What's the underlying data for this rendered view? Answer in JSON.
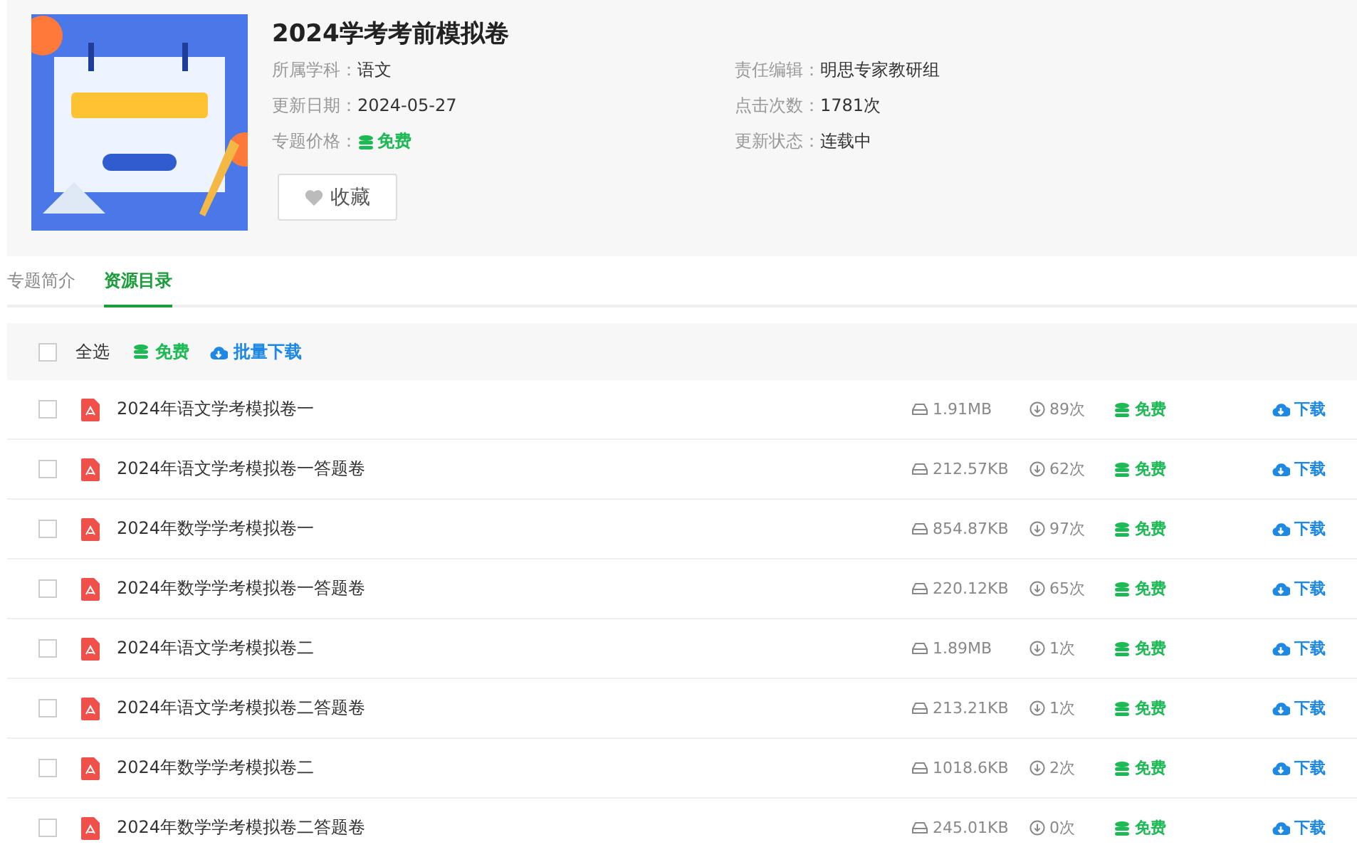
{
  "header": {
    "title": "2024学考考前模拟卷",
    "info": [
      {
        "label": "所属学科：",
        "value": "语文",
        "kind": "text"
      },
      {
        "label": "责任编辑：",
        "value": "明思专家教研组",
        "kind": "text"
      },
      {
        "label": "更新日期：",
        "value": "2024-05-27",
        "kind": "text"
      },
      {
        "label": "点击次数：",
        "value": "1781次",
        "kind": "text"
      },
      {
        "label": "专题价格：",
        "value": "免费",
        "kind": "price"
      },
      {
        "label": "更新状态：",
        "value": "连载中",
        "kind": "text"
      }
    ],
    "favorite_button": "收藏"
  },
  "tabs": [
    {
      "label": "专题简介",
      "selected": false
    },
    {
      "label": "资源目录",
      "selected": true
    }
  ],
  "toolbar": {
    "select_all": {
      "label": "全选",
      "checked": false
    },
    "free": "免费",
    "batch_download": "批量下载"
  },
  "files": [
    {
      "name": "2024年语文学考模拟卷一",
      "size": "1.91MB",
      "downloads": "89次",
      "price": "免费",
      "action": "下载",
      "checked": false
    },
    {
      "name": "2024年语文学考模拟卷一答题卷",
      "size": "212.57KB",
      "downloads": "62次",
      "price": "免费",
      "action": "下载",
      "checked": false
    },
    {
      "name": "2024年数学学考模拟卷一",
      "size": "854.87KB",
      "downloads": "97次",
      "price": "免费",
      "action": "下载",
      "checked": false
    },
    {
      "name": "2024年数学学考模拟卷一答题卷",
      "size": "220.12KB",
      "downloads": "65次",
      "price": "免费",
      "action": "下载",
      "checked": false
    },
    {
      "name": "2024年语文学考模拟卷二",
      "size": "1.89MB",
      "downloads": "1次",
      "price": "免费",
      "action": "下载",
      "checked": false
    },
    {
      "name": "2024年语文学考模拟卷二答题卷",
      "size": "213.21KB",
      "downloads": "1次",
      "price": "免费",
      "action": "下载",
      "checked": false
    },
    {
      "name": "2024年数学学考模拟卷二",
      "size": "1018.6KB",
      "downloads": "2次",
      "price": "免费",
      "action": "下载",
      "checked": false
    },
    {
      "name": "2024年数学学考模拟卷二答题卷",
      "size": "245.01KB",
      "downloads": "0次",
      "price": "免费",
      "action": "下载",
      "checked": false
    }
  ]
}
